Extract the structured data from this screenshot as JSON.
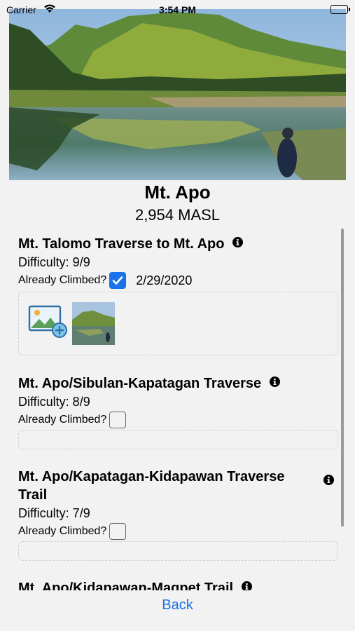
{
  "status_bar": {
    "carrier": "Carrier",
    "time": "3:54 PM"
  },
  "peak": {
    "name": "Mt. Apo",
    "elevation": "2,954 MASL"
  },
  "trails": [
    {
      "title": "Mt. Talomo Traverse to Mt. Apo",
      "difficulty": "Difficulty: 9/9",
      "climbed_label": "Already Climbed?",
      "climbed": true,
      "date": "2/29/2020"
    },
    {
      "title": "Mt. Apo/Sibulan-Kapatagan Traverse",
      "difficulty": "Difficulty: 8/9",
      "climbed_label": "Already Climbed?",
      "climbed": false
    },
    {
      "title_line1": "Mt. Apo/Kapatagan-Kidapawan Traverse",
      "title_line2": "Trail",
      "difficulty": "Difficulty: 7/9",
      "climbed_label": "Already Climbed?",
      "climbed": false
    },
    {
      "title": "Mt. Apo/Kidapawan-Magpet Trail"
    }
  ],
  "icons": {
    "info": "info-icon",
    "add_photo": "add-photo-icon",
    "checkmark": "checkmark-icon",
    "wifi": "wifi-icon",
    "battery": "battery-icon"
  },
  "back_label": "Back",
  "colors": {
    "accent": "#1a73e8"
  }
}
